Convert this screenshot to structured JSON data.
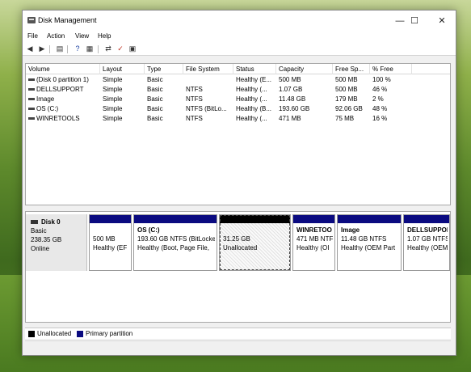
{
  "window": {
    "title": "Disk Management",
    "controls": {
      "minimize": "—",
      "maximize": "☐",
      "close": "✕"
    }
  },
  "menu": [
    "File",
    "Action",
    "View",
    "Help"
  ],
  "toolbar": {
    "icons": [
      "back-arrow-icon",
      "forward-arrow-icon",
      "properties-icon",
      "help-icon",
      "list-view-icon",
      "connect-icon",
      "check-icon",
      "settings-icon"
    ]
  },
  "volume_table": {
    "columns": [
      "Volume",
      "Layout",
      "Type",
      "File System",
      "Status",
      "Capacity",
      "Free Sp...",
      "% Free"
    ],
    "rows": [
      [
        "(Disk 0 partition 1)",
        "Simple",
        "Basic",
        "",
        "Healthy (E...",
        "500 MB",
        "500 MB",
        "100 %"
      ],
      [
        "DELLSUPPORT",
        "Simple",
        "Basic",
        "NTFS",
        "Healthy (...",
        "1.07 GB",
        "500 MB",
        "46 %"
      ],
      [
        "Image",
        "Simple",
        "Basic",
        "NTFS",
        "Healthy (...",
        "11.48 GB",
        "179 MB",
        "2 %"
      ],
      [
        "OS (C:)",
        "Simple",
        "Basic",
        "NTFS (BitLo...",
        "Healthy (B...",
        "193.60 GB",
        "92.06 GB",
        "48 %"
      ],
      [
        "WINRETOOLS",
        "Simple",
        "Basic",
        "NTFS",
        "Healthy (...",
        "471 MB",
        "75 MB",
        "16 %"
      ]
    ]
  },
  "disk": {
    "name": "Disk 0",
    "type": "Basic",
    "size": "238.35 GB",
    "status": "Online"
  },
  "partitions": [
    {
      "name": "",
      "line1": "500 MB",
      "line2": "Healthy (EF",
      "kind": "primary"
    },
    {
      "name": "OS  (C:)",
      "line1": "193.60 GB NTFS (BitLocke",
      "line2": "Healthy (Boot, Page File,",
      "kind": "primary"
    },
    {
      "name": "",
      "line1": "31.25 GB",
      "line2": "Unallocated",
      "kind": "unallocated"
    },
    {
      "name": "WINRETOO",
      "line1": "471 MB NTF",
      "line2": "Healthy (OI",
      "kind": "primary"
    },
    {
      "name": "Image",
      "line1": "11.48 GB NTFS",
      "line2": "Healthy (OEM Part",
      "kind": "primary"
    },
    {
      "name": "DELLSUPPOR",
      "line1": "1.07 GB NTFS",
      "line2": "Healthy (OEM",
      "kind": "primary"
    }
  ],
  "legend": [
    {
      "label": "Unallocated",
      "color": "#000000"
    },
    {
      "label": "Primary partition",
      "color": "#0a0a80"
    }
  ],
  "colors": {
    "primary": "#0a0a80",
    "unallocated": "#000000"
  }
}
